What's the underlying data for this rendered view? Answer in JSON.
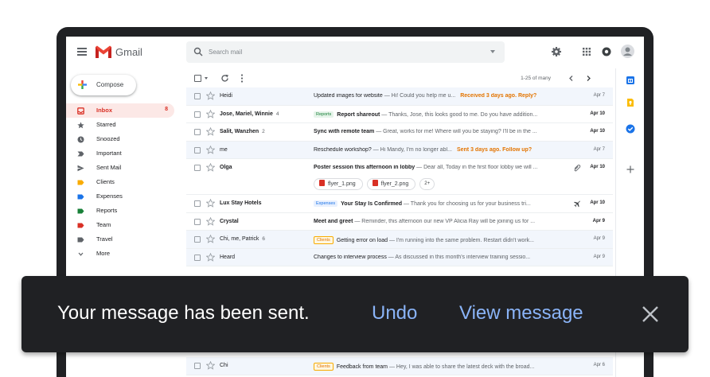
{
  "app": {
    "name": "Gmail"
  },
  "search": {
    "placeholder": "Search mail"
  },
  "compose": {
    "label": "Compose"
  },
  "sidebar": {
    "items": [
      {
        "label": "Inbox",
        "count": "8",
        "icon": "inbox-icon",
        "color": "#d93025",
        "active": true
      },
      {
        "label": "Starred",
        "count": "",
        "icon": "star-icon",
        "color": "#5f6368"
      },
      {
        "label": "Snoozed",
        "count": "",
        "icon": "clock-icon",
        "color": "#5f6368"
      },
      {
        "label": "Important",
        "count": "",
        "icon": "important-icon",
        "color": "#5f6368"
      },
      {
        "label": "Sent Mail",
        "count": "",
        "icon": "send-icon",
        "color": "#5f6368"
      },
      {
        "label": "Clients",
        "count": "",
        "icon": "label-icon",
        "color": "#f9ab00"
      },
      {
        "label": "Expenses",
        "count": "",
        "icon": "label-icon",
        "color": "#1a73e8"
      },
      {
        "label": "Reports",
        "count": "",
        "icon": "label-icon",
        "color": "#188038"
      },
      {
        "label": "Team",
        "count": "",
        "icon": "label-icon",
        "color": "#d93025"
      },
      {
        "label": "Travel",
        "count": "",
        "icon": "label-icon",
        "color": "#5f6368"
      },
      {
        "label": "More",
        "count": "",
        "icon": "chevron-down-icon",
        "color": "#5f6368"
      }
    ]
  },
  "toolbar": {
    "range": "1-25 of many"
  },
  "emails": [
    {
      "sender": "Heidi",
      "count": "",
      "label": "",
      "subject": "Updated images for website",
      "snippet": " — Hi! Could you help me u...",
      "note": "Received 3 days ago. Reply?",
      "date": "Apr 7",
      "unread": false
    },
    {
      "sender": "Jose, Mariel, Winnie",
      "count": "4",
      "label": "Reports",
      "subject": "Report shareout",
      "snippet": " — Thanks, Jose, this looks good to me. Do you have addition...",
      "note": "",
      "date": "Apr 10",
      "unread": true
    },
    {
      "sender": "Salit, Wanzhen",
      "count": "2",
      "label": "",
      "subject": "Sync with remote team",
      "snippet": " — Great, works for me! Where will you be staying? I'll be in the ...",
      "note": "",
      "date": "Apr 10",
      "unread": true
    },
    {
      "sender": "me",
      "count": "",
      "label": "",
      "subject": "Reschedule workshop?",
      "snippet": " — Hi Mandy, I'm no longer abl...",
      "note": "Sent 3 days ago. Follow up?",
      "date": "Apr 7",
      "unread": false
    },
    {
      "sender": "Olga",
      "count": "",
      "label": "",
      "subject": "Poster session this afternoon in lobby",
      "snippet": " — Dear all, Today in the first floor lobby we will ...",
      "note": "",
      "date": "Apr 10",
      "unread": true,
      "attachments": [
        "flyer_1.png",
        "flyer_2.png"
      ],
      "more": "2+"
    },
    {
      "sender": "Lux Stay Hotels",
      "count": "",
      "label": "Expenses",
      "subject": "Your Stay Is Confirmed",
      "snippet": " — Thank you for choosing us for your business tri...",
      "note": "",
      "date": "Apr 10",
      "unread": true
    },
    {
      "sender": "Crystal",
      "count": "",
      "label": "",
      "subject": "Meet and greet",
      "snippet": " — Reminder, this afternoon our new VP Alicia Ray will be joining us for ...",
      "note": "",
      "date": "Apr 9",
      "unread": true
    },
    {
      "sender": "Chi, me, Patrick",
      "count": "6",
      "label": "Clients",
      "subject": "Getting error on load",
      "snippet": " — I'm running into the same problem. Restart didn't work...",
      "note": "",
      "date": "Apr 9",
      "unread": false
    },
    {
      "sender": "Heard",
      "count": "",
      "label": "",
      "subject": "Changes to interview process",
      "snippet": " — As discussed in this month's interview training sessio...",
      "note": "",
      "date": "Apr 9",
      "unread": false
    }
  ],
  "bottom_email": {
    "sender": "Chi",
    "label": "Clients",
    "subject": "Feedback from team",
    "snippet": " — Hey, I was able to share the latest deck with the broad...",
    "date": "Apr 6"
  },
  "toast": {
    "message": "Your message has been sent.",
    "undo": "Undo",
    "view": "View message"
  }
}
